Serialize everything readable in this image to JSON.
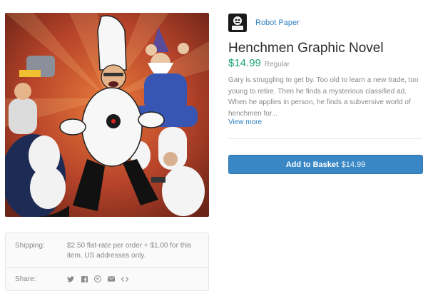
{
  "seller": {
    "name": "Robot Paper",
    "logo_icon": "robot-paper-logo-icon",
    "logo_text": "ROBOT PAPER"
  },
  "product": {
    "title": "Henchmen Graphic Novel",
    "price": "$14.99",
    "price_note": "Regular",
    "description": "Gary is struggling to get by. Too old to learn a new trade, too young to retire. Then he finds a mysterious classified ad. When he applies in person, he finds a subversive world of henchmen for...",
    "view_more_label": "View more",
    "image_icon": "comic-cover-illustration"
  },
  "basket_button": {
    "label": "Add to Basket",
    "amount": "$14.99"
  },
  "shipping": {
    "label": "Shipping:",
    "value": "$2.50 flat-rate per order + $1.00 for this item. US addresses only."
  },
  "share": {
    "label": "Share:",
    "icons": [
      "twitter-icon",
      "facebook-icon",
      "pinterest-icon",
      "email-icon",
      "embed-icon"
    ]
  },
  "colors": {
    "accent_blue": "#3a87c6",
    "link_blue": "#2f7fc1",
    "price_green": "#1aa276"
  }
}
